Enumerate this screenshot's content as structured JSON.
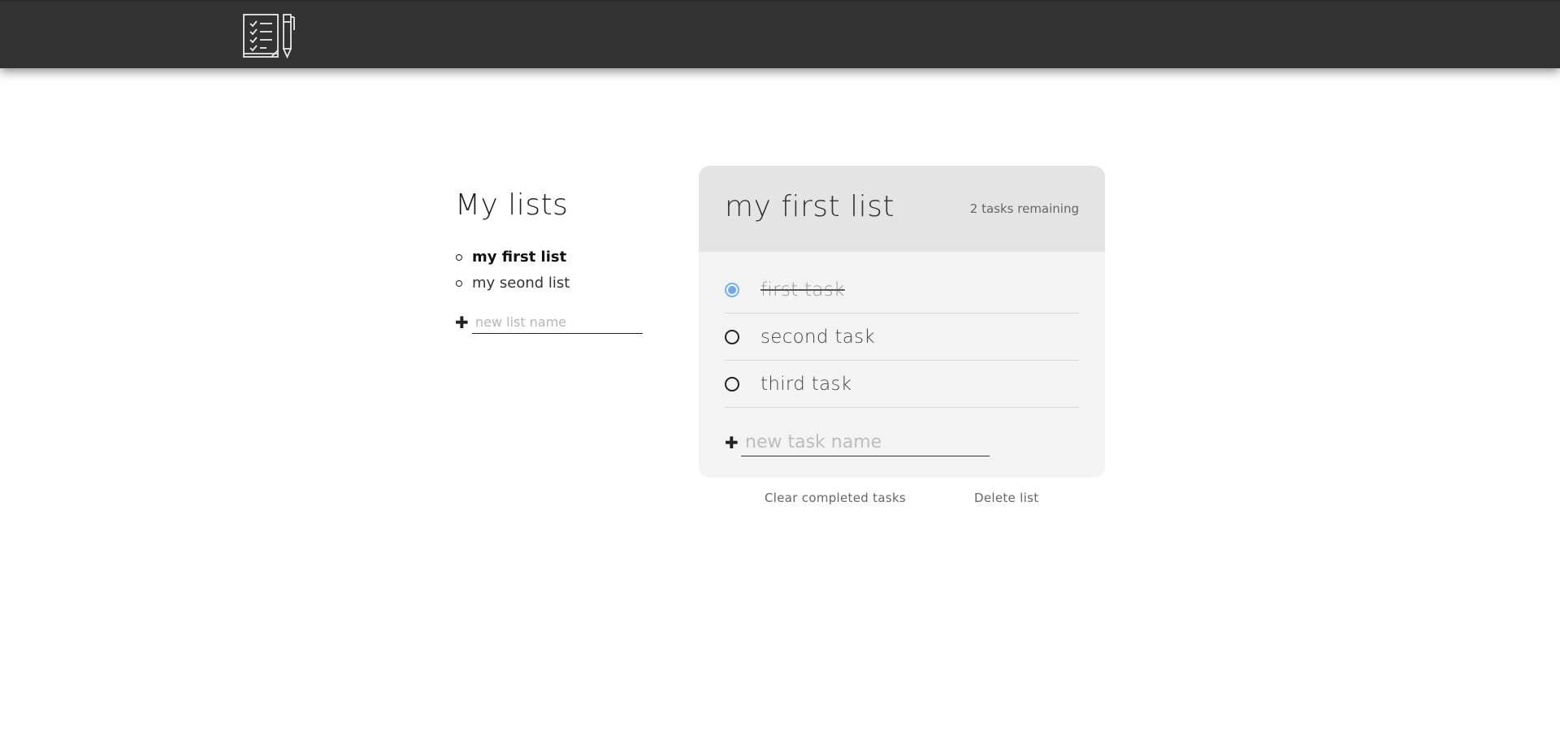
{
  "header": {
    "logo_icon": "checklist-notepad-with-pen-icon",
    "background_color": "#333333"
  },
  "sidebar": {
    "title": "My lists",
    "lists": [
      {
        "label": "my first list",
        "active": true
      },
      {
        "label": "my seond list",
        "active": false
      }
    ],
    "new_list_placeholder": "new list name",
    "add_icon": "plus-icon"
  },
  "list_view": {
    "title": "my first list",
    "tasks_remaining": "2 tasks remaining",
    "tasks": [
      {
        "label": "first task",
        "completed": true
      },
      {
        "label": "second task",
        "completed": false
      },
      {
        "label": "third task",
        "completed": false
      }
    ],
    "new_task_placeholder": "new task name",
    "accent_color": "#6ea8ea"
  },
  "actions": {
    "clear_completed_label": "Clear completed tasks",
    "delete_list_label": "Delete list"
  }
}
